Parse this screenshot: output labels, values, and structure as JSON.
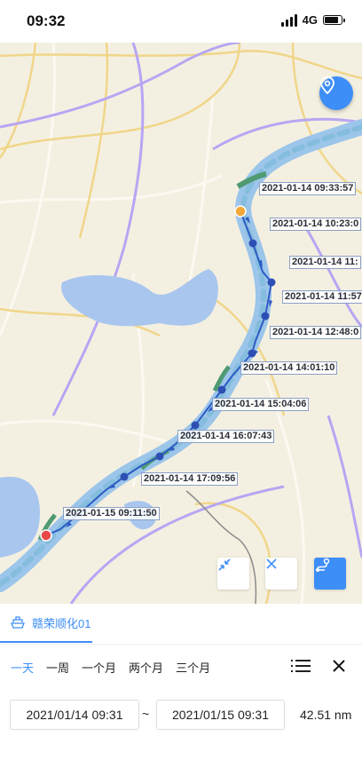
{
  "status_bar": {
    "time": "09:32",
    "network": "4G"
  },
  "map": {
    "route_color": "#2d5bc4",
    "timestamps": [
      "2021-01-14 09:33:57",
      "2021-01-14 10:23:0",
      "2021-01-14 11:",
      "2021-01-14 11:57",
      "2021-01-14 12:48:0",
      "2021-01-14 14:01:10",
      "2021-01-14 15:04:06",
      "2021-01-14 16:07:43",
      "2021-01-14 17:09:56",
      "2021-01-15 09:11:50"
    ]
  },
  "panel": {
    "ship_name": "赣荣顺化01",
    "ranges": [
      "一天",
      "一周",
      "一个月",
      "两个月",
      "三个月"
    ],
    "start_time": "2021/01/14 09:31",
    "end_time": "2021/01/15 09:31",
    "separator": "~",
    "distance": "42.51 nm"
  },
  "colors": {
    "accent": "#3e8ef7"
  }
}
